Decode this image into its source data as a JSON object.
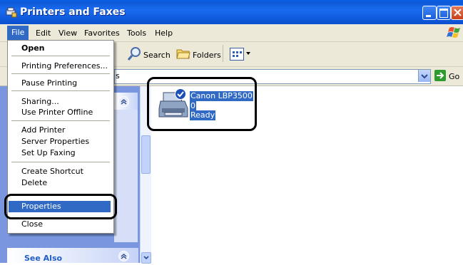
{
  "window": {
    "title": "Printers and Faxes"
  },
  "menubar": {
    "items": [
      "File",
      "Edit",
      "View",
      "Favorites",
      "Tools",
      "Help"
    ]
  },
  "toolbar": {
    "search_label": "Search",
    "folders_label": "Folders"
  },
  "addressbar": {
    "go_label": "Go",
    "address_fragment": "s"
  },
  "file_menu": {
    "items": [
      "Open",
      "Printing Preferences...",
      "Pause Printing",
      "Sharing...",
      "Use Printer Offline",
      "Add Printer",
      "Server Properties",
      "Set Up Faxing",
      "Create Shortcut",
      "Delete",
      "Properties",
      "Close"
    ]
  },
  "printer": {
    "name": "Canon LBP3500",
    "jobs": "0",
    "status": "Ready"
  },
  "left_pane": {
    "see_also_label": "See Also"
  },
  "colors": {
    "title_bar": "#0a5ee6",
    "selection": "#316ac5",
    "menu_bg": "#ece9d8",
    "pane_bg": "#7a96df"
  }
}
